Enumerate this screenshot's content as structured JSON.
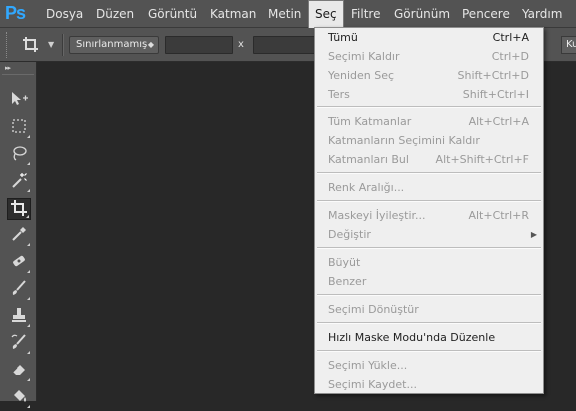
{
  "app": {
    "logo": "Ps",
    "menubar": [
      "Dosya",
      "Düzen",
      "Görüntü",
      "Katman",
      "Metin",
      "Seç",
      "Filtre",
      "Görünüm",
      "Pencere",
      "Yardım"
    ],
    "active_menu": "Seç"
  },
  "options_bar": {
    "tool_glyph": "crop-icon",
    "ratio_value": "Sınırlanmamış",
    "x_separator": "x",
    "clear_label": "Kural"
  },
  "tools": [
    "move-icon",
    "marquee-icon",
    "lasso-icon",
    "magic-wand-icon",
    "crop-icon",
    "eyedropper-icon",
    "healing-brush-icon",
    "brush-icon",
    "clone-stamp-icon",
    "history-brush-icon",
    "eraser-icon",
    "paint-bucket-icon"
  ],
  "selected_tool": "crop-icon",
  "select_menu": {
    "groups": [
      [
        {
          "label": "Tümü",
          "shortcut": "Ctrl+A",
          "disabled": false
        },
        {
          "label": "Seçimi Kaldır",
          "shortcut": "Ctrl+D",
          "disabled": true
        },
        {
          "label": "Yeniden Seç",
          "shortcut": "Shift+Ctrl+D",
          "disabled": true
        },
        {
          "label": "Ters",
          "shortcut": "Shift+Ctrl+I",
          "disabled": true
        }
      ],
      [
        {
          "label": "Tüm Katmanlar",
          "shortcut": "Alt+Ctrl+A",
          "disabled": true
        },
        {
          "label": "Katmanların Seçimini Kaldır",
          "shortcut": "",
          "disabled": true
        },
        {
          "label": "Katmanları Bul",
          "shortcut": "Alt+Shift+Ctrl+F",
          "disabled": true
        }
      ],
      [
        {
          "label": "Renk Aralığı...",
          "shortcut": "",
          "disabled": true
        }
      ],
      [
        {
          "label": "Maskeyi İyileştir...",
          "shortcut": "Alt+Ctrl+R",
          "disabled": true
        },
        {
          "label": "Değiştir",
          "shortcut": "",
          "disabled": true,
          "submenu": true
        }
      ],
      [
        {
          "label": "Büyüt",
          "shortcut": "",
          "disabled": true
        },
        {
          "label": "Benzer",
          "shortcut": "",
          "disabled": true
        }
      ],
      [
        {
          "label": "Seçimi Dönüştür",
          "shortcut": "",
          "disabled": true
        }
      ],
      [
        {
          "label": "Hızlı Maske Modu'nda Düzenle",
          "shortcut": "",
          "disabled": false
        }
      ],
      [
        {
          "label": "Seçimi Yükle...",
          "shortcut": "",
          "disabled": true
        },
        {
          "label": "Seçimi Kaydet...",
          "shortcut": "",
          "disabled": true
        }
      ]
    ]
  }
}
